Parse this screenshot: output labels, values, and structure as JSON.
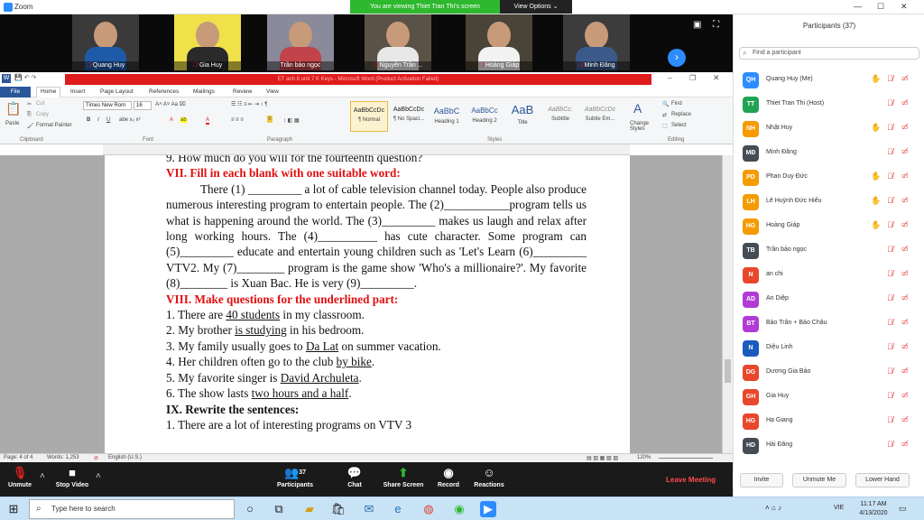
{
  "zoom": {
    "app_title": "Zoom",
    "viewing_banner": "You are viewing Thiet Tran Thi's screen",
    "view_options": "View Options ⌄",
    "participants_count": "37",
    "leave": "Leave Meeting",
    "toolbar": {
      "unmute": "Unmute",
      "stop_video": "Stop Video",
      "participants": "Participants",
      "chat": "Chat",
      "share": "Share Screen",
      "record": "Record",
      "reactions": "Reactions"
    }
  },
  "video_tiles": [
    {
      "name": "Quang Huy"
    },
    {
      "name": "Gia Huy"
    },
    {
      "name": "Trần bảo ngọc"
    },
    {
      "name": "Nguyễn Trần ..."
    },
    {
      "name": "Hoàng Giáp"
    },
    {
      "name": "Minh Đăng"
    }
  ],
  "word": {
    "title": "ET anh 8 unit 7 K Keys - Microsoft Word (Product Activation Failed)",
    "tabs": [
      "File",
      "Home",
      "Insert",
      "Page Layout",
      "References",
      "Mailings",
      "Review",
      "View"
    ],
    "ribbon": {
      "cut": "Cut",
      "copy": "Copy",
      "format_painter": "Format Painter",
      "paste": "Paste",
      "font_name": "Times New Rom",
      "font_size": "16",
      "groups": [
        "Clipboard",
        "Font",
        "Paragraph",
        "Styles",
        "Editing"
      ],
      "styles": [
        {
          "preview": "AaBbCcDc",
          "label": "¶ Normal"
        },
        {
          "preview": "AaBbCcDc",
          "label": "¶ No Spaci..."
        },
        {
          "preview": "AaBbC",
          "label": "Heading 1"
        },
        {
          "preview": "AaBbCc",
          "label": "Heading 2"
        },
        {
          "preview": "AaB",
          "label": "Title"
        },
        {
          "preview": "AaBbCc.",
          "label": "Subtitle"
        },
        {
          "preview": "AaBbCcDc",
          "label": "Subtle Em..."
        }
      ],
      "change_styles": "Change Styles",
      "find": "Find",
      "replace": "Replace",
      "select": "Select"
    },
    "status": {
      "page": "Page: 4 of 4",
      "words": "Words: 1,253",
      "language": "English (U.S.)",
      "zoom": "120%"
    },
    "document": {
      "prev_line": "9. How much do you will for the fourteenth question?",
      "sec7": "VII. Fill in each blank with one suitable word:",
      "para": "There (1) _________ a lot of cable television channel today. People also produce numerous interesting program to entertain people. The (2)___________program tells us what is happening around the world. The (3)_________ makes us laugh and relax after long working hours. The (4)__________ has cute character. Some program can (5)_________ educate and entertain young children such as 'Let's Learn (6)_________ VTV2. My (7)________ program is the game show 'Who's a millionaire?'. My favorite (8)________ is Xuan Bac. He is very (9)_________.",
      "sec8": "VIII. Make questions for the underlined part:",
      "q1a": "1. There are ",
      "q1u": "40 students",
      "q1b": " in my classroom.",
      "q2a": "2. My brother ",
      "q2u": "is studying",
      "q2b": " in his bedroom.",
      "q3a": "3. My family usually goes to ",
      "q3u": "Da Lat",
      "q3b": " on summer vacation.",
      "q4a": "4. Her children often go to the club ",
      "q4u": "by bike",
      "q4b": ".",
      "q5a": "5. My favorite singer is ",
      "q5u": "David Archuleta",
      "q5b": ".",
      "q6a": "6. The show lasts ",
      "q6u": "two hours and a half",
      "q6b": ".",
      "sec9": "IX. Rewrite the sentences:",
      "r1": "1. There are a lot of interesting programs on VTV 3"
    }
  },
  "panel": {
    "title": "Participants (37)",
    "find_placeholder": "Find a participant",
    "participants": [
      {
        "initials": "QH",
        "name": "Quang Huy (Me)",
        "color": "#2d8cff"
      },
      {
        "initials": "TT",
        "name": "Thiet Tran Thi (Host)",
        "color": "#21a353"
      },
      {
        "initials": "NH",
        "name": "Nhật Huy",
        "color": "#f59b00"
      },
      {
        "initials": "MĐ",
        "name": "Minh Đăng",
        "color": "#444c56"
      },
      {
        "initials": "PD",
        "name": "Phan Duy Đức",
        "color": "#f59b00"
      },
      {
        "initials": "LH",
        "name": "Lê Huỳnh Đức Hiếu",
        "color": "#f59b00"
      },
      {
        "initials": "HG",
        "name": "Hoàng Giáp",
        "color": "#f59b00"
      },
      {
        "initials": "TB",
        "name": "Trần bảo ngọc",
        "color": "#444c56"
      },
      {
        "initials": "N",
        "name": "an chi",
        "color": "#e8472b"
      },
      {
        "initials": "AD",
        "name": "An Diệp",
        "color": "#b23bd4"
      },
      {
        "initials": "BT",
        "name": "Bảo Trân + Bảo Châu",
        "color": "#b23bd4"
      },
      {
        "initials": "N",
        "name": "Diệu Linh",
        "color": "#1a5bbf"
      },
      {
        "initials": "DG",
        "name": "Dương Gia Bảo",
        "color": "#e8472b"
      },
      {
        "initials": "GH",
        "name": "Gia Huy",
        "color": "#e8472b"
      },
      {
        "initials": "HG",
        "name": "Hạ Giang",
        "color": "#e8472b"
      },
      {
        "initials": "HD",
        "name": "Hải Đăng",
        "color": "#444c56"
      }
    ],
    "buttons": {
      "invite": "Invite",
      "unmute_me": "Unmute Me",
      "lower_hand": "Lower Hand"
    }
  },
  "taskbar": {
    "search_placeholder": "Type here to search",
    "language": "VIE",
    "time": "11:17 AM",
    "date": "4/13/2020"
  }
}
